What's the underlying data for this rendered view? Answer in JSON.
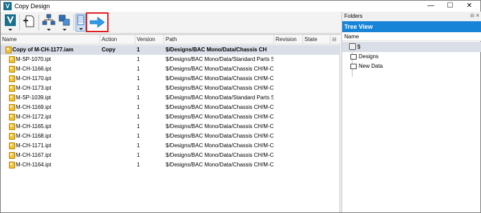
{
  "window": {
    "title": "Copy Design",
    "app_icon_letter": "V",
    "controls": [
      "—",
      "☐",
      "✕"
    ]
  },
  "toolbar": {
    "buttons": [
      {
        "name": "vault-menu-button",
        "icon": "vault-v-icon",
        "has_dropdown": true
      },
      {
        "name": "add-files-button",
        "icon": "add-file-icon",
        "has_dropdown": false
      },
      {
        "name": "select-structure-button",
        "icon": "hierarchy-icon",
        "has_dropdown": true
      },
      {
        "name": "copy-options-button",
        "icon": "copy-stack-icon",
        "has_dropdown": true
      },
      {
        "name": "grid-view-button",
        "icon": "grid-view-icon",
        "has_dropdown": true
      },
      {
        "name": "next-button",
        "icon": "arrow-right-icon",
        "has_dropdown": false,
        "highlighted": true
      }
    ]
  },
  "grid": {
    "columns": [
      "Name",
      "Action",
      "Version",
      "Path",
      "Revision",
      "State"
    ],
    "rows": [
      {
        "name": "Copy of M-CH-1177.iam",
        "action": "Copy",
        "version": "1",
        "path": "$/Designs/BAC Mono/Data/Chassis CH",
        "revision": "",
        "state": "",
        "bold": true,
        "selected": true
      },
      {
        "name": "M-SP-1070.ipt",
        "action": "",
        "version": "1",
        "path": "$/Designs/BAC Mono/Data/Standard Parts SP",
        "revision": "",
        "state": ""
      },
      {
        "name": "M-CH-1166.ipt",
        "action": "",
        "version": "1",
        "path": "$/Designs/BAC Mono/Data/Chassis CH/M-C...",
        "revision": "",
        "state": ""
      },
      {
        "name": "M-CH-1170.ipt",
        "action": "",
        "version": "1",
        "path": "$/Designs/BAC Mono/Data/Chassis CH/M-C...",
        "revision": "",
        "state": ""
      },
      {
        "name": "M-CH-1173.ipt",
        "action": "",
        "version": "1",
        "path": "$/Designs/BAC Mono/Data/Chassis CH/M-C...",
        "revision": "",
        "state": ""
      },
      {
        "name": "M-SP-1039.ipt",
        "action": "",
        "version": "1",
        "path": "$/Designs/BAC Mono/Data/Standard Parts SP",
        "revision": "",
        "state": ""
      },
      {
        "name": "M-CH-1169.ipt",
        "action": "",
        "version": "1",
        "path": "$/Designs/BAC Mono/Data/Chassis CH/M-C...",
        "revision": "",
        "state": ""
      },
      {
        "name": "M-CH-1172.ipt",
        "action": "",
        "version": "1",
        "path": "$/Designs/BAC Mono/Data/Chassis CH/M-C...",
        "revision": "",
        "state": ""
      },
      {
        "name": "M-CH-1165.ipt",
        "action": "",
        "version": "1",
        "path": "$/Designs/BAC Mono/Data/Chassis CH/M-C...",
        "revision": "",
        "state": ""
      },
      {
        "name": "M-CH-1168.ipt",
        "action": "",
        "version": "1",
        "path": "$/Designs/BAC Mono/Data/Chassis CH/M-C...",
        "revision": "",
        "state": ""
      },
      {
        "name": "M-CH-1171.ipt",
        "action": "",
        "version": "1",
        "path": "$/Designs/BAC Mono/Data/Chassis CH/M-C...",
        "revision": "",
        "state": ""
      },
      {
        "name": "M-CH-1167.ipt",
        "action": "",
        "version": "1",
        "path": "$/Designs/BAC Mono/Data/Chassis CH/M-C...",
        "revision": "",
        "state": ""
      },
      {
        "name": "M-CH-1164.ipt",
        "action": "",
        "version": "1",
        "path": "$/Designs/BAC Mono/Data/Chassis CH/M-C...",
        "revision": "",
        "state": ""
      }
    ]
  },
  "folders_pane": {
    "title": "Folders",
    "pin_glyphs": "⊟ ✕",
    "header": "Tree View",
    "column": "Name",
    "root": "$",
    "children": [
      "Designs",
      "New Data"
    ]
  },
  "colors": {
    "accent": "#1784d8",
    "selection": "#d9dee7",
    "highlight_border": "#e02020"
  }
}
